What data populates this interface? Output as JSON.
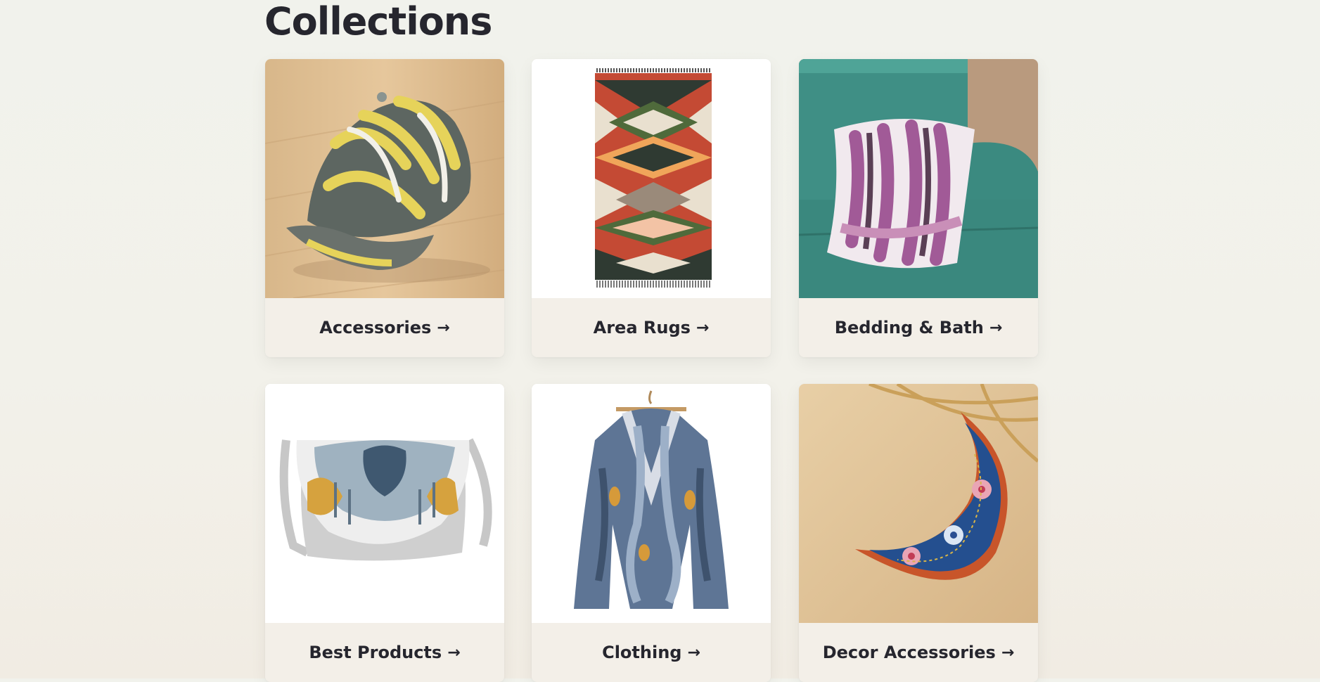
{
  "page": {
    "title": "Collections"
  },
  "collections": [
    {
      "label": "Accessories",
      "icon": "arrow-right-icon"
    },
    {
      "label": "Area Rugs",
      "icon": "arrow-right-icon"
    },
    {
      "label": "Bedding & Bath",
      "icon": "arrow-right-icon"
    },
    {
      "label": "Best Products",
      "icon": "arrow-right-icon"
    },
    {
      "label": "Clothing",
      "icon": "arrow-right-icon"
    },
    {
      "label": "Decor Accessories",
      "icon": "arrow-right-icon"
    }
  ],
  "arrow_glyph": "→"
}
